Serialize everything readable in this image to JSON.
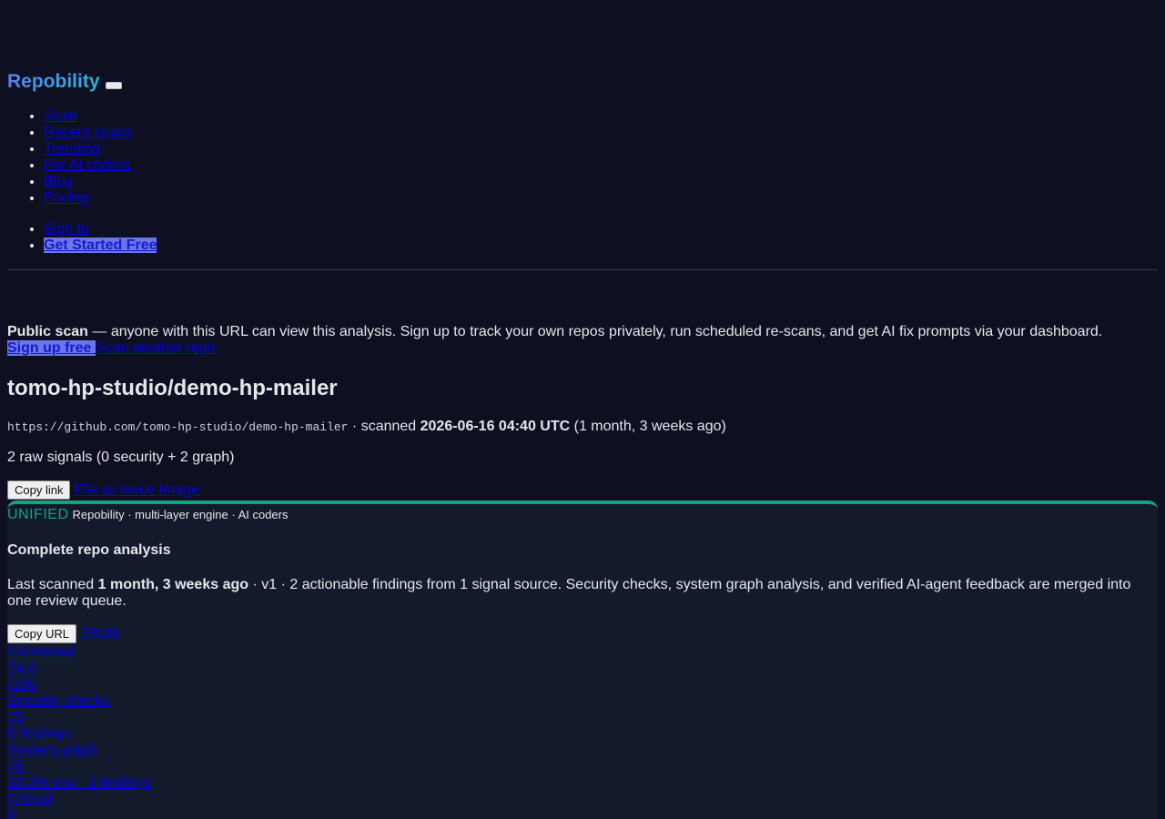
{
  "header": {
    "brand": "Repobility",
    "nav": [
      "Scan",
      "Recent scans",
      "Trending",
      "For AI coders",
      "Blog",
      "Pricing"
    ],
    "auth": {
      "sign_in": "Sign In",
      "get_started": "Get Started Free"
    }
  },
  "notice": {
    "strong": "Public scan",
    "text": " — anyone with this URL can view this analysis. Sign up to track your own repos privately, run scheduled re-scans, and get AI fix prompts via your dashboard.",
    "signup": "Sign up free ",
    "scan_another": "Scan another repo"
  },
  "repo": {
    "title": "tomo-hp-studio/demo-hp-mailer",
    "url": "https://github.com/tomo-hp-studio/demo-hp-mailer",
    "scanned_prefix": " · scanned ",
    "scanned_at": "2026-06-16 04:40 UTC",
    "scanned_rel": " (1 month, 3 weeks ago)",
    "signals": "2 raw signals (0 security + 2 graph)"
  },
  "actions": {
    "copy_link": "Copy link",
    "file_issue": "File as issue",
    "image": "Image"
  },
  "panel": {
    "badge": "UNIFIED",
    "badge_sub": "Repobility · multi-layer engine · AI coders",
    "title": "Complete repo analysis",
    "desc_prefix": "Last scanned ",
    "desc_when": "1 month, 3 weeks ago",
    "desc_rest": " · v1 · 2 actionable findings from 1 signal source. Security checks, system graph analysis, and verified AI-agent feedback are merged into one review queue.",
    "copy_url": "Copy URL",
    "json": "JSON",
    "accent": "#16a37a"
  },
  "scores": [
    {
      "label": "Combined",
      "value": "74.8",
      "sub": "/100"
    },
    {
      "label": "Security checks",
      "value": "75",
      "sub": "0 findings"
    },
    {
      "label": "System graph",
      "value": "75",
      "sub": "33.3% cov · 2 findings"
    },
    {
      "label": "Critical",
      "value": "0"
    }
  ]
}
